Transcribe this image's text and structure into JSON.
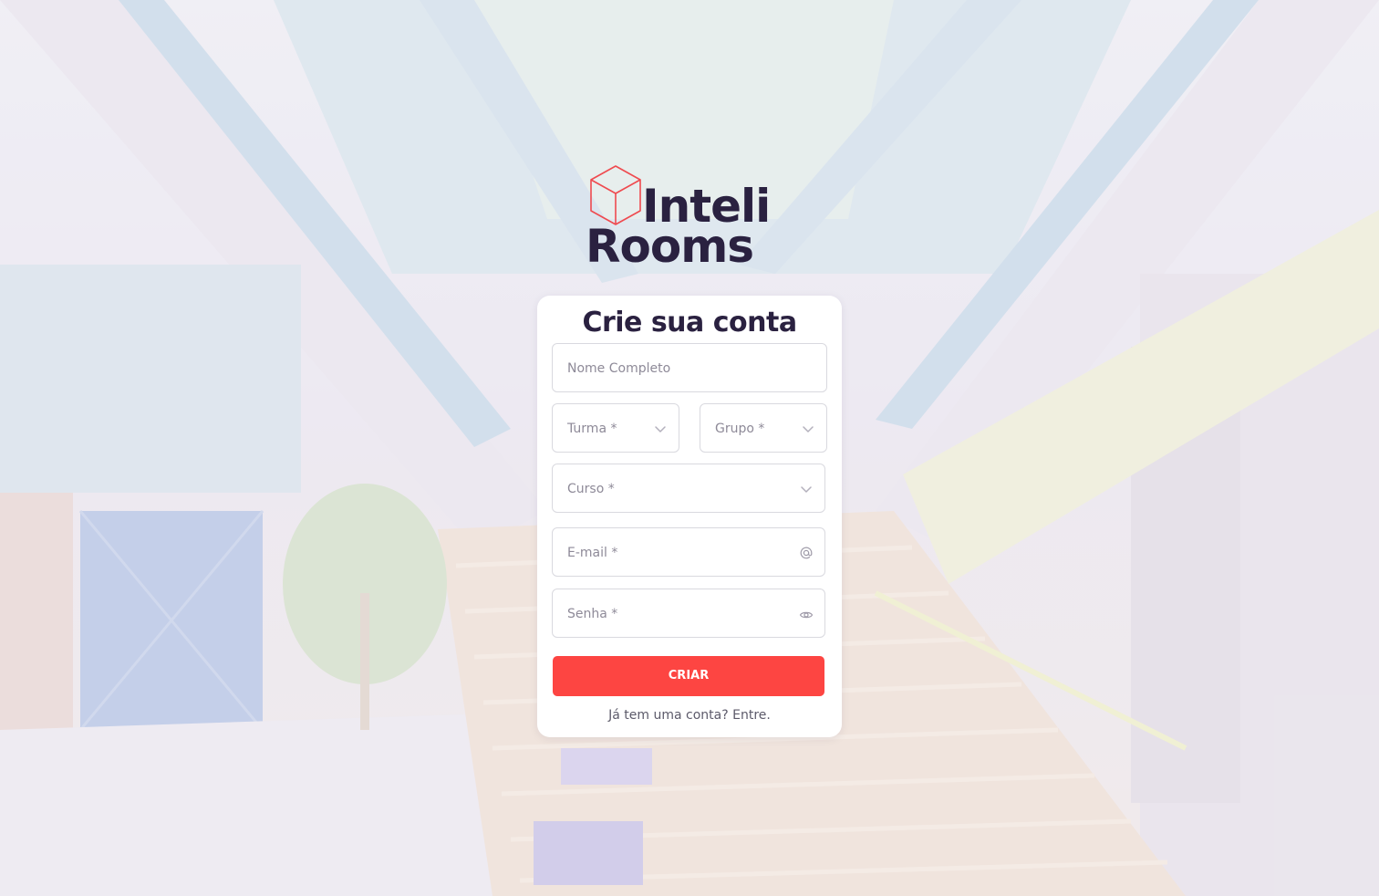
{
  "logo": {
    "line1": "Inteli",
    "line2": "Rooms",
    "cube_color": "#ef4a4f",
    "text_color": "#2a2140"
  },
  "form": {
    "title": "Crie sua conta",
    "fields": {
      "nome": {
        "placeholder": "Nome Completo"
      },
      "turma": {
        "placeholder": "Turma *",
        "icon": "chevron-down-icon"
      },
      "grupo": {
        "placeholder": "Grupo *",
        "icon": "chevron-down-icon"
      },
      "curso": {
        "placeholder": "Curso *",
        "icon": "chevron-down-icon"
      },
      "email": {
        "placeholder": "E-mail *",
        "icon": "at-sign-icon"
      },
      "senha": {
        "placeholder": "Senha *",
        "icon": "eye-icon"
      }
    },
    "submit_label": "CRIAR",
    "login_prompt": "Já tem uma conta?",
    "login_link": "Entre."
  },
  "colors": {
    "accent": "#fd4542",
    "heading": "#2a2140",
    "placeholder": "#8e8a98",
    "card_background": "#ffffff"
  }
}
